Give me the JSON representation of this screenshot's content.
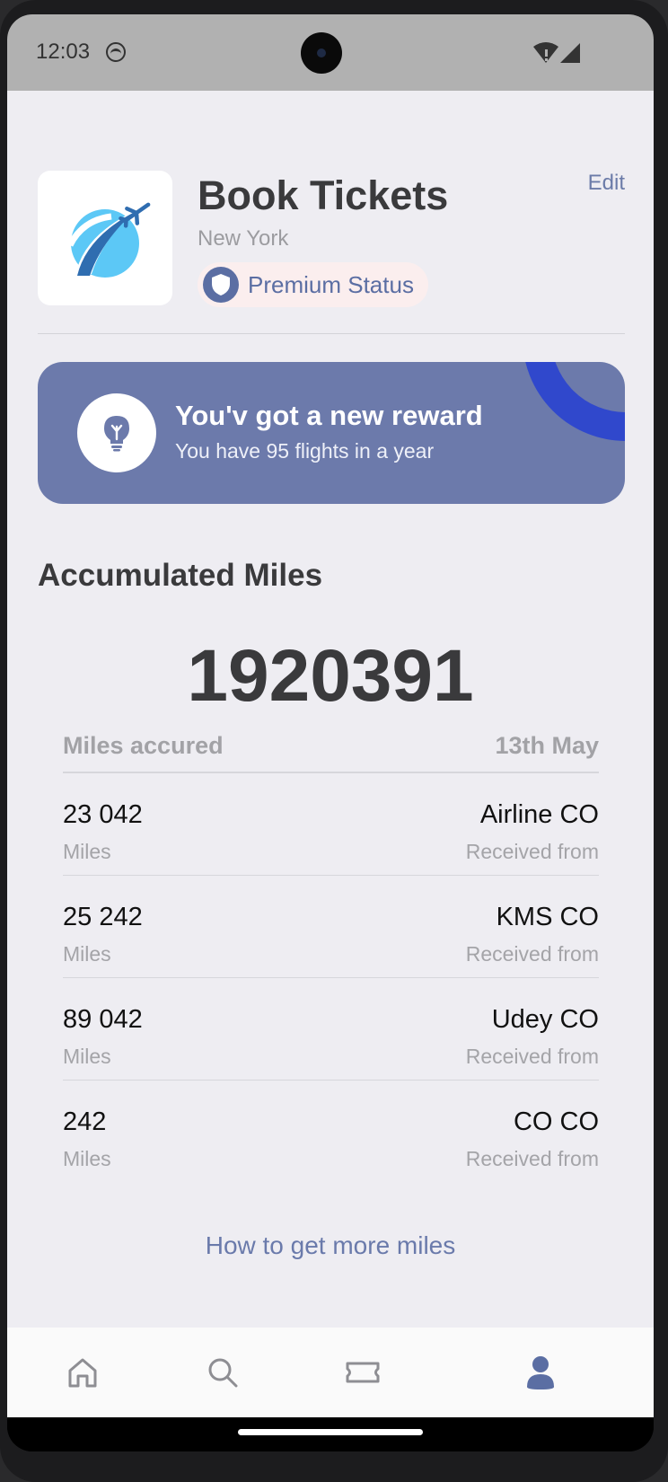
{
  "status_bar": {
    "time": "12:03"
  },
  "header": {
    "title": "Book Tickets",
    "subtitle": "New York",
    "edit_label": "Edit",
    "badge_label": "Premium Status"
  },
  "reward": {
    "title": "You'v got a new reward",
    "subtitle": "You have 95 flights in a year"
  },
  "miles": {
    "heading": "Accumulated Miles",
    "total": "1920391",
    "table_header_left": "Miles accured",
    "table_header_right": "13th May",
    "rows": [
      {
        "amount": "23 042",
        "unit": "Miles",
        "company": "Airline CO",
        "source_label": "Received from"
      },
      {
        "amount": "25 242",
        "unit": "Miles",
        "company": "KMS CO",
        "source_label": "Received from"
      },
      {
        "amount": "89 042",
        "unit": "Miles",
        "company": "Udey CO",
        "source_label": "Received from"
      },
      {
        "amount": "242",
        "unit": "Miles",
        "company": "CO CO",
        "source_label": "Received from"
      }
    ],
    "more_link": "How to get more miles"
  },
  "nav": {
    "items": [
      {
        "icon": "home-icon"
      },
      {
        "icon": "search-icon"
      },
      {
        "icon": "ticket-icon"
      },
      {
        "icon": "profile-icon",
        "active": true
      }
    ]
  },
  "colors": {
    "accent": "#6c7aab",
    "brand_dark": "#5b6ea3",
    "background": "#eeedf2",
    "reward_deco": "#3048cc"
  }
}
